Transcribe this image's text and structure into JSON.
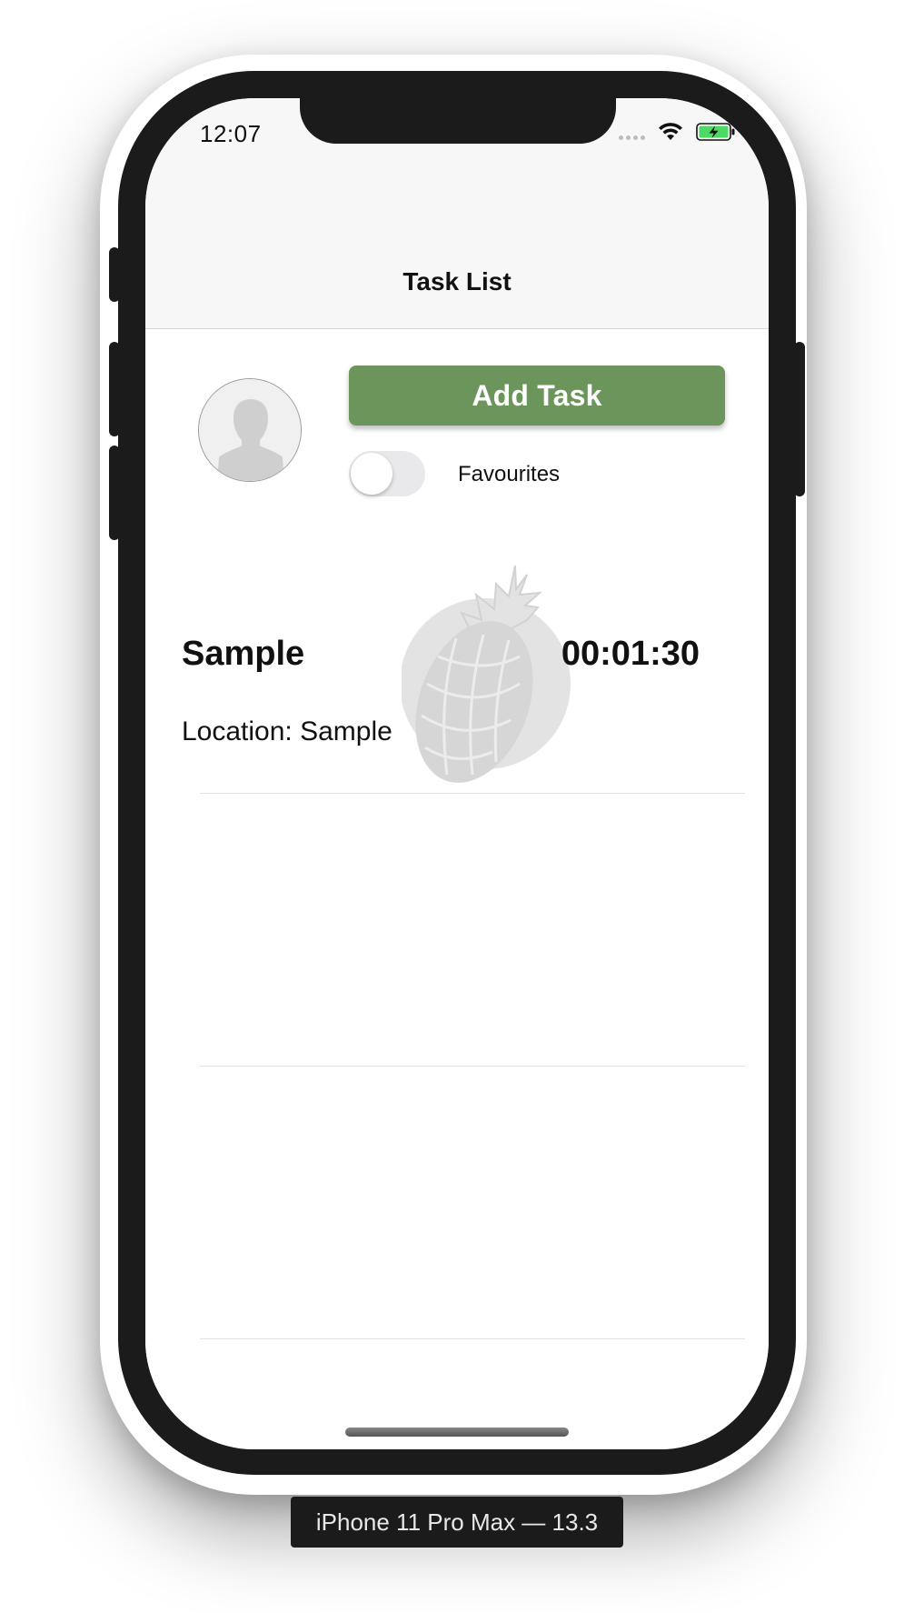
{
  "status_bar": {
    "time": "12:07"
  },
  "nav_bar": {
    "title": "Task List"
  },
  "header": {
    "add_task_label": "Add Task",
    "favourites_label": "Favourites",
    "favourites_on": false
  },
  "tasks": [
    {
      "title": "Sample",
      "elapsed": "00:01:30",
      "location": "Location: Sample"
    }
  ],
  "device_label": "iPhone 11 Pro Max — 13.3",
  "colors": {
    "accent": "#6c955c",
    "battery": "#4cd964"
  }
}
